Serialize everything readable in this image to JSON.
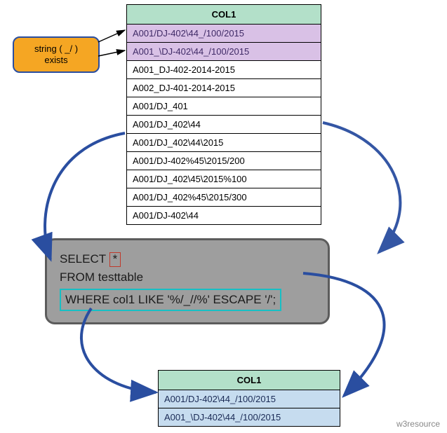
{
  "callout": {
    "line1": "string ( _/ )",
    "line2": "exists"
  },
  "source_table": {
    "header": "COL1",
    "rows": [
      {
        "v": "A001/DJ-402\\44_/100/2015",
        "match": true
      },
      {
        "v": "A001_\\DJ-402\\44_/100/2015",
        "match": true
      },
      {
        "v": "A001_DJ-402-2014-2015",
        "match": false
      },
      {
        "v": "A002_DJ-401-2014-2015",
        "match": false
      },
      {
        "v": "A001/DJ_401",
        "match": false
      },
      {
        "v": "A001/DJ_402\\44",
        "match": false
      },
      {
        "v": "A001/DJ_402\\44\\2015",
        "match": false
      },
      {
        "v": "A001/DJ-402%45\\2015/200",
        "match": false
      },
      {
        "v": "A001/DJ_402\\45\\2015%100",
        "match": false
      },
      {
        "v": "A001/DJ_402%45\\2015/300",
        "match": false
      },
      {
        "v": "A001/DJ-402\\44",
        "match": false
      }
    ]
  },
  "sql": {
    "select_kw": "SELECT",
    "star": "*",
    "from_line": "FROM testtable",
    "where_line": "WHERE col1   LIKE '%/_//%' ESCAPE '/';"
  },
  "result_table": {
    "header": "COL1",
    "rows": [
      "A001/DJ-402\\44_/100/2015",
      "A001_\\DJ-402\\44_/100/2015"
    ]
  },
  "credit": "w3resource"
}
